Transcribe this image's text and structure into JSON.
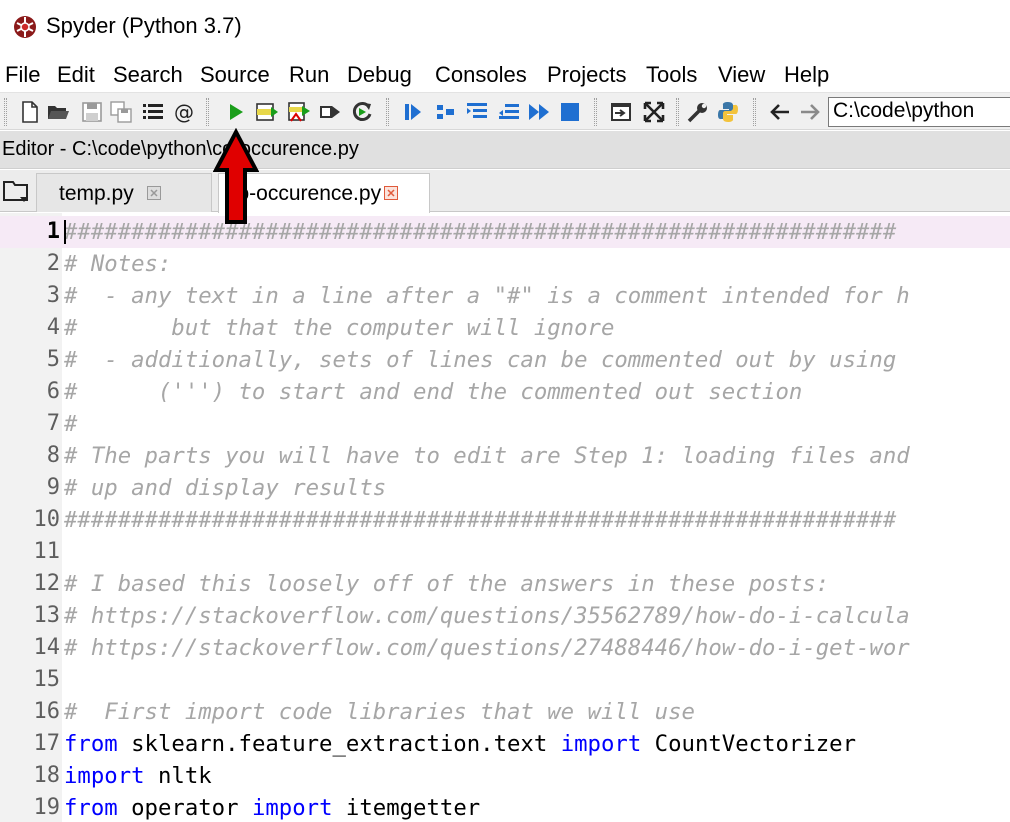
{
  "window": {
    "title": "Spyder (Python 3.7)"
  },
  "menu": [
    "File",
    "Edit",
    "Search",
    "Source",
    "Run",
    "Debug",
    "Consoles",
    "Projects",
    "Tools",
    "View",
    "Help"
  ],
  "toolbar": {
    "path": "C:\\code\\python",
    "icons": [
      "new-file-icon",
      "open-file-icon",
      "save-icon",
      "save-all-icon",
      "outline-icon",
      "at-icon",
      "run-icon",
      "run-cell-icon",
      "run-cell-advance-icon",
      "run-selection-icon",
      "rerun-icon",
      "debug-icon",
      "step-icon",
      "step-into-icon",
      "step-return-icon",
      "continue-icon",
      "stop-icon",
      "maximize-pane-icon",
      "fullscreen-icon",
      "preferences-icon",
      "python-path-icon",
      "back-icon",
      "forward-icon"
    ]
  },
  "editor": {
    "title": "Editor - C:\\code\\python\\co-occurence.py",
    "tabs": [
      {
        "label": "temp.py",
        "active": false
      },
      {
        "label": "co-occurence.py",
        "active": true
      }
    ]
  },
  "code_lines": [
    {
      "num": "1",
      "current": true,
      "tokens": [
        {
          "t": "##############################################################",
          "c": "cm"
        }
      ]
    },
    {
      "num": "2",
      "tokens": [
        {
          "t": "# Notes:",
          "c": "cm"
        }
      ]
    },
    {
      "num": "3",
      "tokens": [
        {
          "t": "#  - any text in a line after a \"#\" is a comment intended for h",
          "c": "cm"
        }
      ]
    },
    {
      "num": "4",
      "tokens": [
        {
          "t": "#       but that the computer will ignore",
          "c": "cm"
        }
      ]
    },
    {
      "num": "5",
      "tokens": [
        {
          "t": "#  - additionally, sets of lines can be commented out by using",
          "c": "cm"
        }
      ]
    },
    {
      "num": "6",
      "tokens": [
        {
          "t": "#      (''') to start and end the commented out section",
          "c": "cm"
        }
      ]
    },
    {
      "num": "7",
      "tokens": [
        {
          "t": "#",
          "c": "cm"
        }
      ]
    },
    {
      "num": "8",
      "tokens": [
        {
          "t": "# The parts you will have to edit are Step 1: loading files and",
          "c": "cm"
        }
      ]
    },
    {
      "num": "9",
      "tokens": [
        {
          "t": "# up and display results",
          "c": "cm"
        }
      ]
    },
    {
      "num": "10",
      "tokens": [
        {
          "t": "##############################################################",
          "c": "cm"
        }
      ]
    },
    {
      "num": "11",
      "tokens": []
    },
    {
      "num": "12",
      "tokens": [
        {
          "t": "# I based this loosely off of the answers in these posts:",
          "c": "cm"
        }
      ]
    },
    {
      "num": "13",
      "tokens": [
        {
          "t": "# https://stackoverflow.com/questions/35562789/how-do-i-calcula",
          "c": "cm"
        }
      ]
    },
    {
      "num": "14",
      "tokens": [
        {
          "t": "# https://stackoverflow.com/questions/27488446/how-do-i-get-wor",
          "c": "cm"
        }
      ]
    },
    {
      "num": "15",
      "tokens": []
    },
    {
      "num": "16",
      "tokens": [
        {
          "t": "#  First import code libraries that we will use",
          "c": "cm"
        }
      ]
    },
    {
      "num": "17",
      "tokens": [
        {
          "t": "from",
          "c": "kw"
        },
        {
          "t": " sklearn.feature_extraction.text ",
          "c": "tx"
        },
        {
          "t": "import",
          "c": "kw"
        },
        {
          "t": " CountVectorizer",
          "c": "tx"
        }
      ]
    },
    {
      "num": "18",
      "tokens": [
        {
          "t": "import",
          "c": "kw"
        },
        {
          "t": " nltk",
          "c": "tx"
        }
      ]
    },
    {
      "num": "19",
      "tokens": [
        {
          "t": "from",
          "c": "kw"
        },
        {
          "t": " operator ",
          "c": "tx"
        },
        {
          "t": "import",
          "c": "kw"
        },
        {
          "t": " itemgetter",
          "c": "tx"
        }
      ]
    }
  ],
  "colors": {
    "comment": "#a6a6a6",
    "keyword": "#0000ff",
    "run_green": "#1a9e1a",
    "debug_blue": "#1f6fd1",
    "annotation_arrow": "#e00000"
  }
}
